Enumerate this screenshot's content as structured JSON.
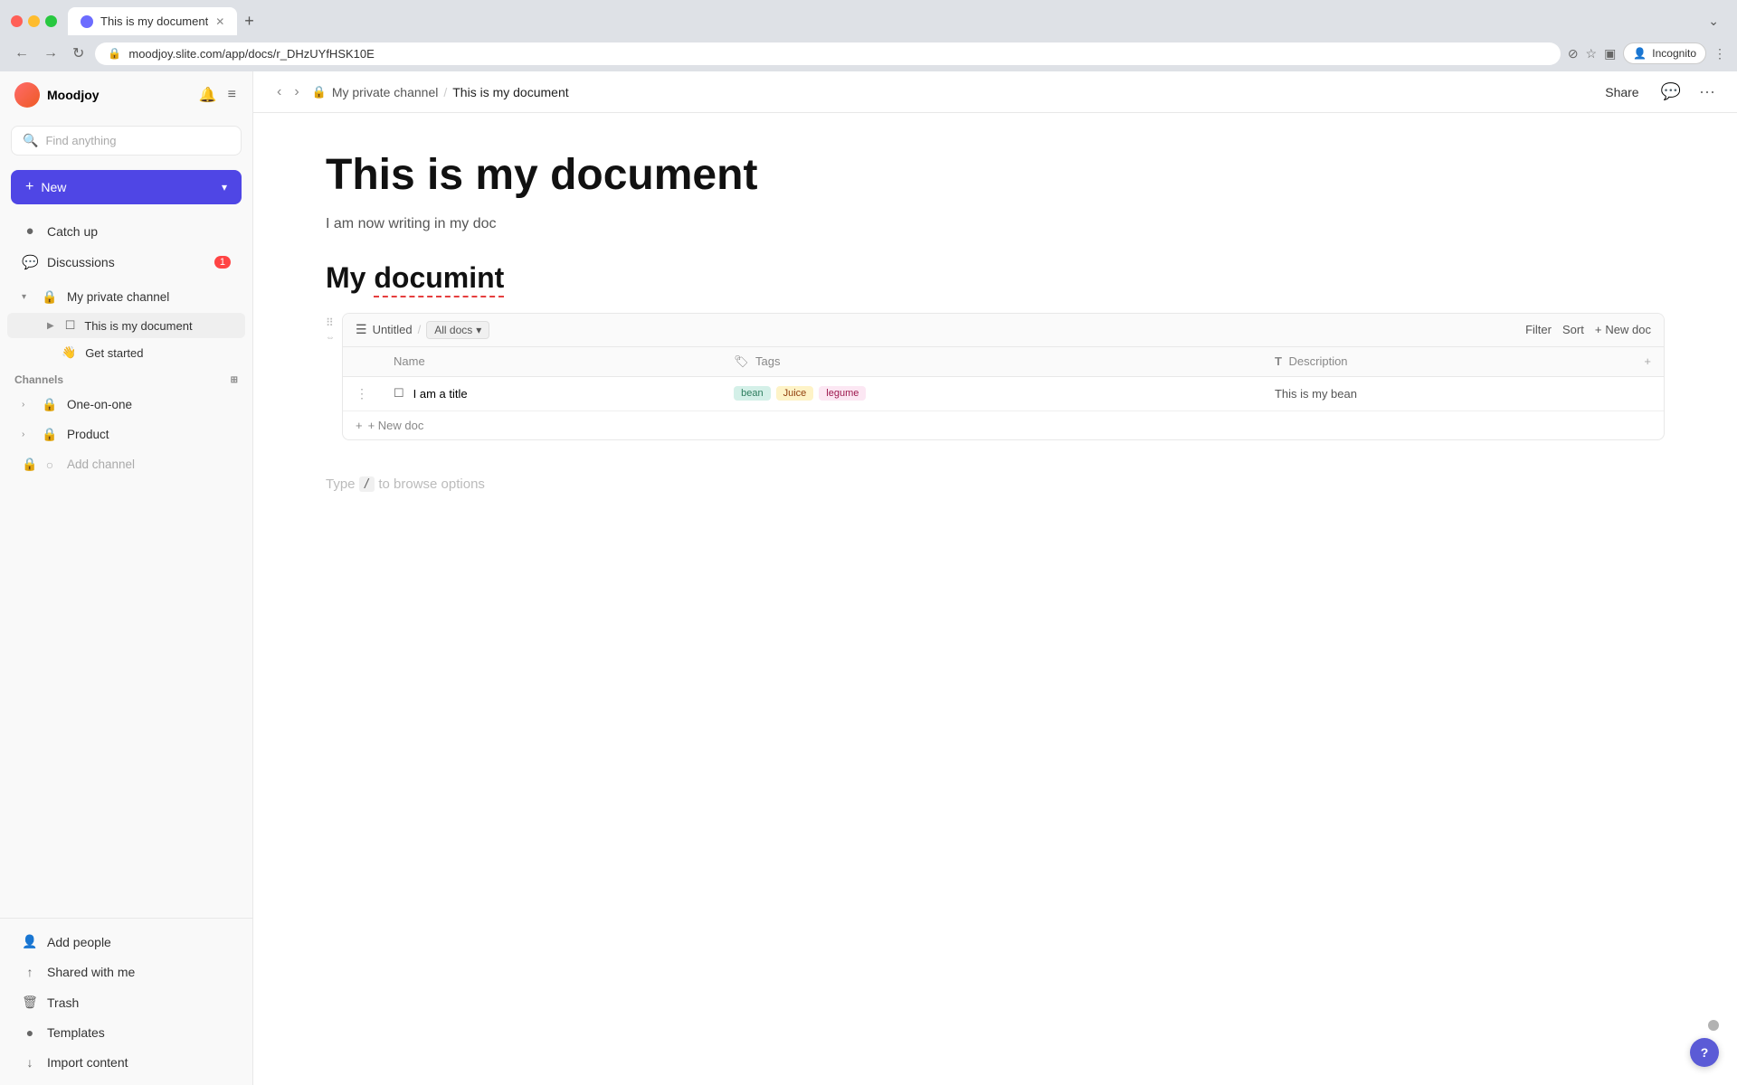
{
  "browser": {
    "tab_title": "This is my document",
    "url": "moodjoy.slite.com/app/docs/r_DHzUYfHSK10E",
    "new_tab_label": "+",
    "nav_back": "←",
    "nav_forward": "→",
    "nav_refresh": "↻",
    "profile_label": "Incognito"
  },
  "sidebar": {
    "workspace_name": "Moodjoy",
    "search_placeholder": "Find anything",
    "new_button": "New",
    "nav_items": [
      {
        "id": "catch-up",
        "icon": "●",
        "label": "Catch up"
      },
      {
        "id": "discussions",
        "icon": "💬",
        "label": "Discussions",
        "badge": "1"
      }
    ],
    "channels_label": "Channels",
    "my_private_channel": "My private channel",
    "doc_item": "This is my document",
    "get_started": "Get started",
    "channels": [
      {
        "id": "one-on-one",
        "label": "One-on-one"
      },
      {
        "id": "product",
        "label": "Product"
      }
    ],
    "add_channel": "Add channel",
    "bottom_items": [
      {
        "id": "add-people",
        "icon": "👤",
        "label": "Add people"
      },
      {
        "id": "shared-with-me",
        "icon": "⬆",
        "label": "Shared with me"
      },
      {
        "id": "trash",
        "icon": "🗑",
        "label": "Trash"
      },
      {
        "id": "templates",
        "icon": "●",
        "label": "Templates"
      },
      {
        "id": "import-content",
        "icon": "⬇",
        "label": "Import content"
      }
    ]
  },
  "topbar": {
    "breadcrumb_workspace": "My private channel",
    "breadcrumb_doc": "This is my document",
    "share_label": "Share",
    "more_label": "···"
  },
  "content": {
    "doc_title": "This is my document",
    "doc_subtitle": "I am now writing in my doc",
    "doc_heading": "My documint",
    "type_hint": "Type",
    "type_slash": "/",
    "type_hint_suffix": "to browse options"
  },
  "database": {
    "icon": "☰",
    "title": "Untitled",
    "view_label": "All docs",
    "filter_label": "Filter",
    "sort_label": "Sort",
    "new_doc_label": "+ New doc",
    "columns": [
      {
        "id": "name",
        "label": "Name"
      },
      {
        "id": "tags",
        "label": "Tags",
        "icon": "🏷"
      },
      {
        "id": "description",
        "label": "Description",
        "icon": "T"
      }
    ],
    "rows": [
      {
        "id": "row1",
        "name": "I am a title",
        "tags": [
          {
            "label": "bean",
            "class": "tag-bean"
          },
          {
            "label": "Juice",
            "class": "tag-juice"
          },
          {
            "label": "legume",
            "class": "tag-legume"
          }
        ],
        "description": "This is my bean"
      }
    ],
    "add_row_label": "+ New doc"
  },
  "icons": {
    "search": "🔍",
    "bell": "🔔",
    "collapse": "≡",
    "lock": "🔒",
    "chevron_right": "›",
    "chevron_down": "▾",
    "chevron_left": "‹",
    "expand_collapse": "⟨⟩",
    "drag": "⠿",
    "menu_dots": "⋯",
    "plus": "+",
    "doc_icon": "📄",
    "hand_emoji": "👋"
  },
  "colors": {
    "accent": "#4f46e5",
    "sidebar_bg": "#f9f9f9",
    "active_bg": "#efefef",
    "border": "#e8e8e8"
  }
}
